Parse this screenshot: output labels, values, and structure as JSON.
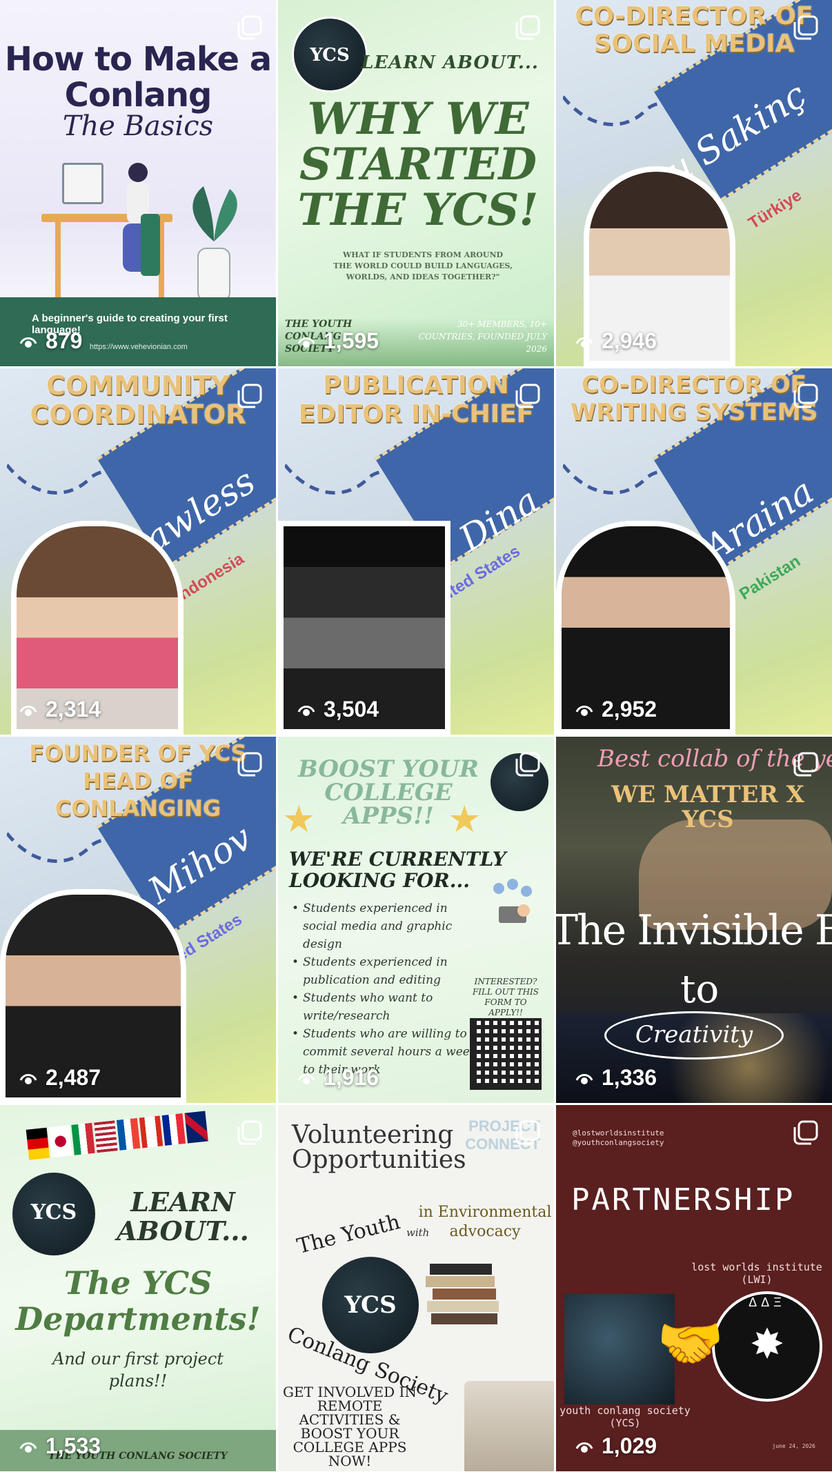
{
  "colors": {
    "staff_band": "#3f66a8",
    "role_text": "#e9c27a",
    "view_text": "#ffffff",
    "partnership_bg": "#5a1f1f"
  },
  "icons": {
    "multi_post": "carousel-icon",
    "views": "eye-icon"
  },
  "tiles": [
    {
      "id": "conlang-basics",
      "title": "How to Make a Conlang",
      "subtitle": "The Basics",
      "caption": "A beginner's guide to creating your first language!",
      "url": "https://www.vehevionian.com",
      "views": "879"
    },
    {
      "id": "why-we-started",
      "logo": "YCS",
      "kicker": "LEARN ABOUT...",
      "headline": "WHY WE STARTED THE YCS!",
      "question": "WHAT IF STUDENTS FROM AROUND THE WORLD COULD BUILD LANGUAGES, WORLDS, AND IDEAS TOGETHER?\"",
      "footer_left": "THE YOUTH CONLANG SOCIETY",
      "footer_right": "30+ MEMBERS, 10+ COUNTRIES, FOUNDED JULY 2026",
      "views": "1,595"
    },
    {
      "id": "social-media",
      "role": "CO-DIRECTOR OF SOCIAL MEDIA",
      "name": "Duru Sakinç",
      "country": "Türkiye",
      "country_color": "#d24a5a",
      "views": "2,946"
    },
    {
      "id": "community",
      "role": "COMMUNITY COORDINATOR",
      "name": "Flawless",
      "country": "Indonesia",
      "country_color": "#d24a5a",
      "views": "2,314"
    },
    {
      "id": "publication",
      "role": "PUBLICATION EDITOR IN-CHIEF",
      "name": "Dina",
      "country": "United States",
      "country_color": "#6d6ae0",
      "views": "3,504"
    },
    {
      "id": "writing-systems",
      "role": "CO-DIRECTOR OF WRITING SYSTEMS",
      "name": "Araina",
      "country": "Pakistan",
      "country_color": "#3fa85a",
      "views": "2,952"
    },
    {
      "id": "founder",
      "role": "FOUNDER OF YCS HEAD OF CONLANGING",
      "name": "Max Mihov",
      "country": "United States",
      "country_color": "#6d6ae0",
      "views": "2,487"
    },
    {
      "id": "boost",
      "headline": "BOOST YOUR COLLEGE APPS!!",
      "subhead": "WE'RE CURRENTLY LOOKING FOR...",
      "bullets": [
        "Students experienced in social media and graphic design",
        "Students experienced in publication and editing",
        "Students who want to write/research",
        "Students who are willing to commit several hours a week to their work"
      ],
      "cta": "INTERESTED? FILL OUT THIS FORM TO APPLY!!",
      "views": "1,916"
    },
    {
      "id": "barrier",
      "collab": "Best collab of the year",
      "matter": "WE MATTER X YCS",
      "line1": "The Invisible Barrier",
      "line2": "to",
      "line3": "Creativity",
      "views": "1,336"
    },
    {
      "id": "departments",
      "logo": "YCS",
      "kicker": "LEARN ABOUT...",
      "headline": "The YCS Departments!",
      "sub": "And our first project plans!!",
      "footer": "THE YOUTH CONLANG SOCIETY",
      "views": "1,533"
    },
    {
      "id": "volunteering",
      "title": "Volunteering Opportunities",
      "project": "PROJECT CONNECT",
      "env": "in Environmental advocacy",
      "with": "with",
      "ring_top": "The Youth",
      "logo": "YCS",
      "ring_bottom": "Conlang Society",
      "cta": "GET INVOLVED IN REMOTE ACTIVITIES & BOOST YOUR COLLEGE APPS NOW!"
    },
    {
      "id": "partnership",
      "handles": "@lostworldsinstitute @youthconlangsociety",
      "title": "PARTNERSHIP",
      "lwi": "lost worlds institute (LWI)",
      "ycs": "youth conlang society (YCS)",
      "date": "june 24, 2026",
      "views": "1,029"
    }
  ]
}
